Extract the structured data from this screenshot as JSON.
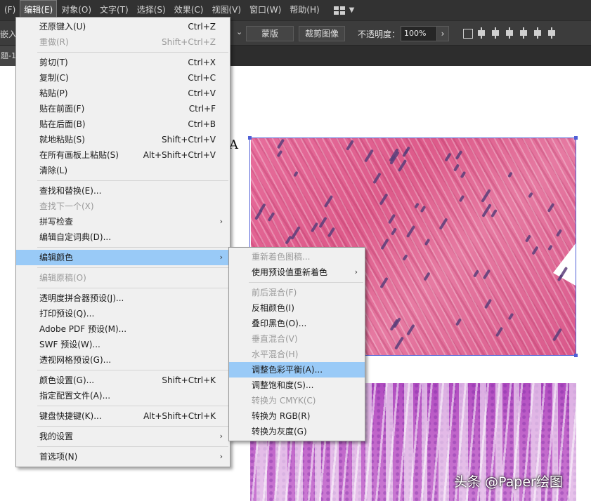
{
  "menubar": {
    "items": [
      {
        "label": "(F)"
      },
      {
        "label": "编辑(E)",
        "active": true
      },
      {
        "label": "对象(O)"
      },
      {
        "label": "文字(T)"
      },
      {
        "label": "选择(S)"
      },
      {
        "label": "效果(C)"
      },
      {
        "label": "视图(V)"
      },
      {
        "label": "窗口(W)"
      },
      {
        "label": "帮助(H)"
      }
    ]
  },
  "control_bar": {
    "embed_label": "嵌入",
    "mask_button": "蒙版",
    "crop_button": "裁剪图像",
    "opacity_label": "不透明度：",
    "opacity_value": "100%"
  },
  "document_tab": {
    "label": "题-1*"
  },
  "edit_menu": {
    "items": [
      {
        "label": "还原键入(U)",
        "shortcut": "Ctrl+Z"
      },
      {
        "label": "重做(R)",
        "shortcut": "Shift+Ctrl+Z",
        "disabled": true
      },
      {
        "separator": true
      },
      {
        "label": "剪切(T)",
        "shortcut": "Ctrl+X"
      },
      {
        "label": "复制(C)",
        "shortcut": "Ctrl+C"
      },
      {
        "label": "粘贴(P)",
        "shortcut": "Ctrl+V"
      },
      {
        "label": "贴在前面(F)",
        "shortcut": "Ctrl+F"
      },
      {
        "label": "贴在后面(B)",
        "shortcut": "Ctrl+B"
      },
      {
        "label": "就地粘贴(S)",
        "shortcut": "Shift+Ctrl+V"
      },
      {
        "label": "在所有画板上粘贴(S)",
        "shortcut": "Alt+Shift+Ctrl+V"
      },
      {
        "label": "清除(L)"
      },
      {
        "separator": true
      },
      {
        "label": "查找和替换(E)..."
      },
      {
        "label": "查找下一个(X)",
        "disabled": true
      },
      {
        "label": "拼写检查",
        "submenu": true
      },
      {
        "label": "编辑自定词典(D)..."
      },
      {
        "separator": true
      },
      {
        "label": "编辑颜色",
        "submenu": true,
        "highlight": true
      },
      {
        "separator": true
      },
      {
        "label": "编辑原稿(O)",
        "disabled": true
      },
      {
        "separator": true
      },
      {
        "label": "透明度拼合器预设(J)..."
      },
      {
        "label": "打印预设(Q)..."
      },
      {
        "label": "Adobe PDF 预设(M)..."
      },
      {
        "label": "SWF 预设(W)..."
      },
      {
        "label": "透视网格预设(G)..."
      },
      {
        "separator": true
      },
      {
        "label": "颜色设置(G)...",
        "shortcut": "Shift+Ctrl+K"
      },
      {
        "label": "指定配置文件(A)..."
      },
      {
        "separator": true
      },
      {
        "label": "键盘快捷键(K)...",
        "shortcut": "Alt+Shift+Ctrl+K"
      },
      {
        "separator": true
      },
      {
        "label": "我的设置",
        "submenu": true
      },
      {
        "separator": true
      },
      {
        "label": "首选项(N)",
        "submenu": true
      }
    ]
  },
  "edit_color_submenu": {
    "items": [
      {
        "label": "重新着色图稿...",
        "disabled": true
      },
      {
        "label": "使用预设值重新着色",
        "submenu": true
      },
      {
        "separator": true
      },
      {
        "label": "前后混合(F)",
        "disabled": true
      },
      {
        "label": "反相颜色(I)"
      },
      {
        "label": "叠印黑色(O)..."
      },
      {
        "label": "垂直混合(V)",
        "disabled": true
      },
      {
        "label": "水平混合(H)",
        "disabled": true
      },
      {
        "label": "调整色彩平衡(A)...",
        "highlight": true
      },
      {
        "label": "调整饱和度(S)..."
      },
      {
        "label": "转换为 CMYK(C)",
        "disabled": true
      },
      {
        "label": "转换为 RGB(R)"
      },
      {
        "label": "转换为灰度(G)"
      }
    ]
  },
  "canvas": {
    "partial_glyph": "A",
    "watermark": "头条 @Paper绘图"
  },
  "colors": {
    "menubar_bg": "#323232",
    "menu_bg": "#f0f0f0",
    "highlight": "#99caf7",
    "selection": "#4f5fd6"
  }
}
